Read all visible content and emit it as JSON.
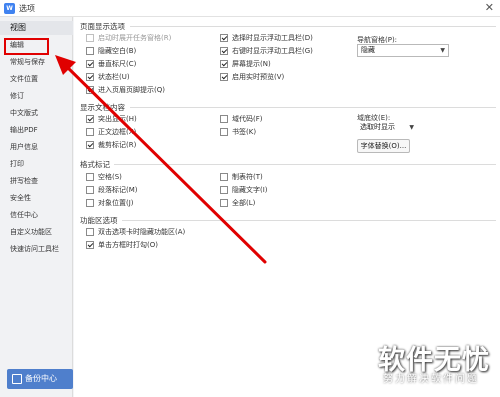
{
  "window": {
    "title": "选项",
    "app_icon": "W"
  },
  "sidebar": {
    "items": [
      {
        "label": "视图"
      },
      {
        "label": "编辑"
      },
      {
        "label": "常规与保存"
      },
      {
        "label": "文件位置"
      },
      {
        "label": "修订"
      },
      {
        "label": "中文版式"
      },
      {
        "label": "输出PDF"
      },
      {
        "label": "用户信息"
      },
      {
        "label": "打印"
      },
      {
        "label": "拼写检查"
      },
      {
        "label": "安全性"
      },
      {
        "label": "信任中心"
      },
      {
        "label": "自定义功能区"
      },
      {
        "label": "快速访问工具栏"
      }
    ],
    "backup_button": "备份中心"
  },
  "page_display": {
    "title": "页面显示选项",
    "options": [
      {
        "label": "启动时展开任务窗格(R)",
        "checked": false,
        "disabled": true
      },
      {
        "label": "隐藏空白(B)",
        "checked": false
      },
      {
        "label": "垂直标尺(C)",
        "checked": true
      },
      {
        "label": "状态栏(U)",
        "checked": true
      },
      {
        "label": "进入页眉页脚提示(Q)",
        "checked": true
      },
      {
        "label": "选择时显示浮动工具栏(D)",
        "checked": true
      },
      {
        "label": "右键时显示浮动工具栏(G)",
        "checked": true
      },
      {
        "label": "屏幕提示(N)",
        "checked": true
      },
      {
        "label": "启用实时预览(V)",
        "checked": true
      }
    ],
    "nav_pane_label": "导航窗格(P):",
    "nav_pane_value": "隐藏"
  },
  "doc_content": {
    "title": "显示文档内容",
    "options": [
      {
        "label": "突出显示(H)",
        "checked": true
      },
      {
        "label": "正文边框(X)",
        "checked": false
      },
      {
        "label": "裁剪标记(R)",
        "checked": true
      },
      {
        "label": "域代码(F)",
        "checked": false
      },
      {
        "label": "书签(K)",
        "checked": false
      }
    ],
    "field_shading_label": "域底纹(E):",
    "field_shading_value": "选取时显示",
    "font_replace_button": "字体替换(O)..."
  },
  "format_marks": {
    "title": "格式标记",
    "options": [
      {
        "label": "空格(S)",
        "checked": false
      },
      {
        "label": "段落标记(M)",
        "checked": false
      },
      {
        "label": "对象位置(J)",
        "checked": false
      },
      {
        "label": "制表符(T)",
        "checked": false
      },
      {
        "label": "隐藏文字(I)",
        "checked": false
      },
      {
        "label": "全部(L)",
        "checked": false
      }
    ]
  },
  "ribbon": {
    "title": "功能区选项",
    "options": [
      {
        "label": "双击选项卡时隐藏功能区(A)",
        "checked": false
      },
      {
        "label": "单击方框时打勾(O)",
        "checked": true
      }
    ]
  },
  "watermark": {
    "main": "软件无忧",
    "sub": "努力解决软件问题"
  },
  "colors": {
    "accent": "#3f82f0",
    "highlight": "#e00000",
    "backup": "#4f7fcc"
  }
}
